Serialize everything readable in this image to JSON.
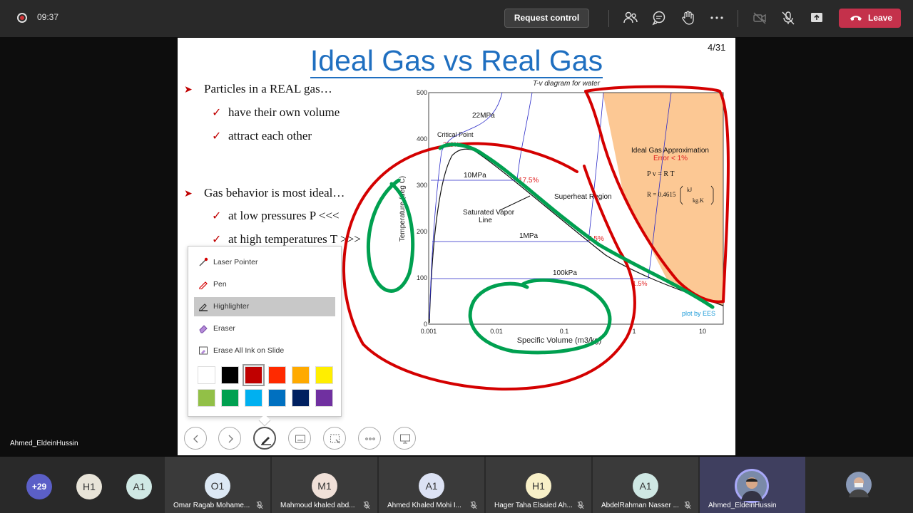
{
  "meeting": {
    "timer": "09:37",
    "request_control": "Request control",
    "leave": "Leave",
    "presenter_name": "Ahmed_EldeinHussin"
  },
  "slide": {
    "title": "Ideal Gas vs Real Gas",
    "page": "4/31",
    "bullets": [
      {
        "text": "Particles in a REAL gas…",
        "subs": [
          "have their own volume",
          "attract each other"
        ]
      },
      {
        "text": "Gas behavior is most ideal…",
        "subs": [
          "at low pressures P <<<",
          "at high temperatures T >>>"
        ]
      }
    ],
    "diagram": {
      "title": "T-v diagram for water",
      "ylabel": "Temperature (deg C)",
      "xlabel": "Specific Volume (m3/kg)",
      "yticks": [
        "500",
        "400",
        "300",
        "200",
        "100",
        "0"
      ],
      "xticks": [
        "0.001",
        "0.01",
        "0.1",
        "1",
        "10"
      ],
      "labels": {
        "p22": "22MPa",
        "critical": "Critical Point",
        "critical_pct": "330%",
        "p10": "10MPa",
        "p10_pct": "17.5%",
        "sat_vapor_1": "Saturated Vapor",
        "sat_vapor_2": "Line",
        "superheat": "Superheat Region",
        "p1": "1MPa",
        "p1_pct": "7.5%",
        "p100k": "100kPa",
        "p100k_pct": "1.5%",
        "ideal_title": "Ideal Gas Approximation",
        "ideal_err": "Error < 1%",
        "eq1": "P v = R T",
        "eq2_left": "R = 0.4615",
        "eq2_num": "kJ",
        "eq2_den": "kg.K",
        "credit": "plot by EES"
      }
    }
  },
  "pen_menu": {
    "items": [
      "Laser Pointer",
      "Pen",
      "Highlighter",
      "Eraser",
      "Erase All Ink on Slide"
    ],
    "selected": "Highlighter",
    "colors": [
      "#ffffff",
      "#000000",
      "#c00000",
      "#ff2a00",
      "#ffaa00",
      "#ffee00",
      "#92c047",
      "#00a050",
      "#00b0f0",
      "#0070c0",
      "#002060",
      "#7030a0"
    ],
    "selected_color": "#c00000"
  },
  "participants": [
    {
      "initials": "+29",
      "name": ""
    },
    {
      "initials": "H1",
      "name": ""
    },
    {
      "initials": "A1",
      "name": ""
    },
    {
      "initials": "O1",
      "name": "Omar Ragab Mohame..."
    },
    {
      "initials": "M1",
      "name": "Mahmoud khaled abd..."
    },
    {
      "initials": "A1",
      "name": "Ahmed Khaled Mohi I..."
    },
    {
      "initials": "H1",
      "name": "Hager Taha Elsaied Ah..."
    },
    {
      "initials": "A1",
      "name": "AbdelRahman Nasser ..."
    },
    {
      "initials": "",
      "name": "Ahmed_EldeinHussin"
    }
  ]
}
